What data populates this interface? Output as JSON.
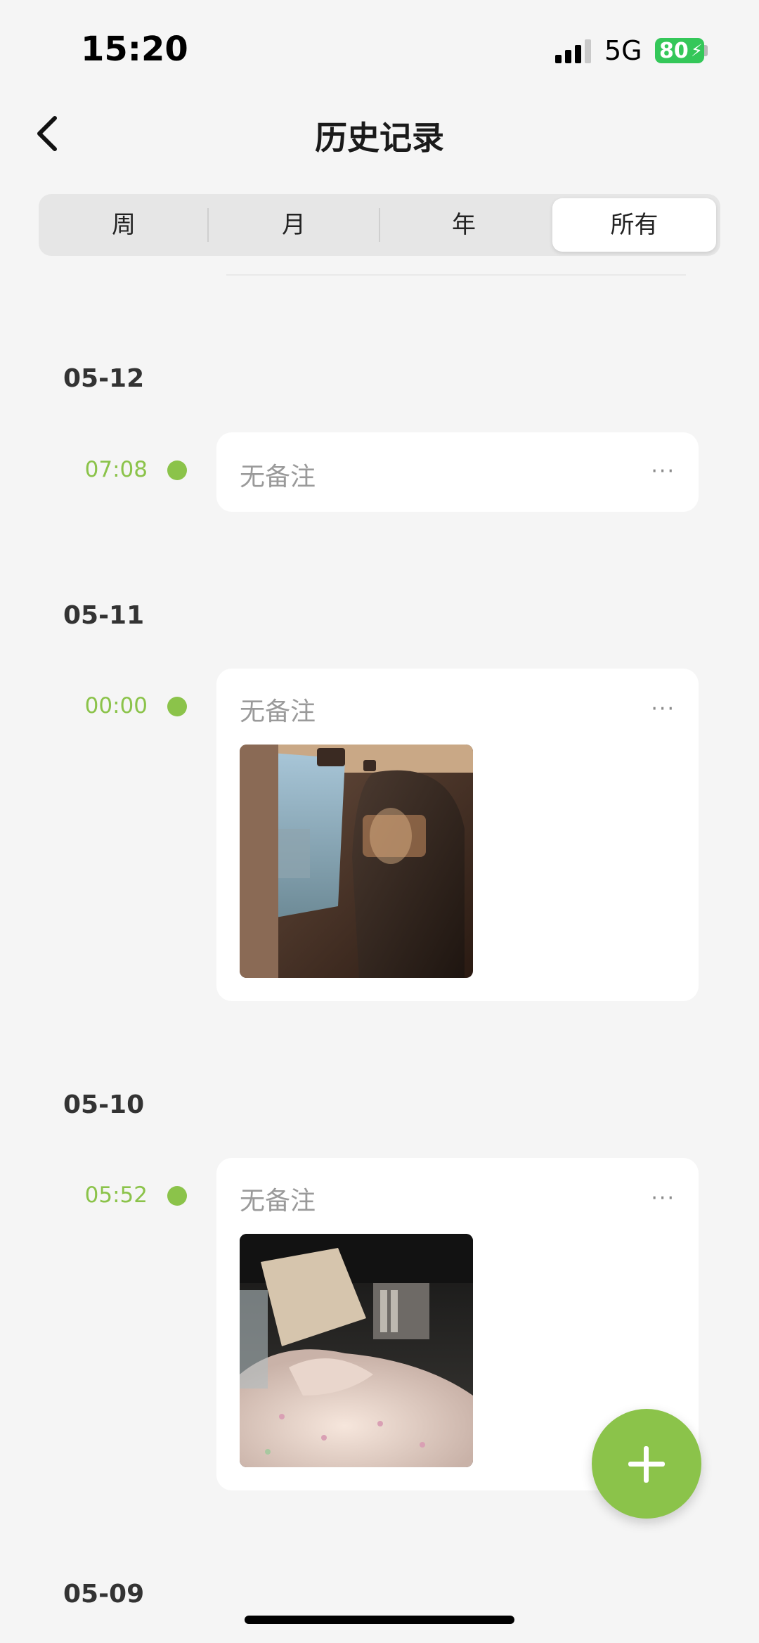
{
  "status_bar": {
    "time": "15:20",
    "network": "5G",
    "battery": "80"
  },
  "header": {
    "title": "历史记录"
  },
  "tabs": [
    {
      "label": "周",
      "active": false
    },
    {
      "label": "月",
      "active": false
    },
    {
      "label": "年",
      "active": false
    },
    {
      "label": "所有",
      "active": true
    }
  ],
  "entries": [
    {
      "date": "05-12",
      "time": "07:08",
      "note": "无备注",
      "more": "···",
      "photo": null
    },
    {
      "date": "05-11",
      "time": "00:00",
      "note": "无备注",
      "more": "···",
      "photo": "car interior from rear seat"
    },
    {
      "date": "05-10",
      "time": "05:52",
      "note": "无备注",
      "more": "···",
      "photo": "blanket on seat"
    },
    {
      "date": "05-09"
    }
  ],
  "colors": {
    "accent": "#8bc34a",
    "background": "#f5f5f5",
    "card": "#ffffff"
  },
  "fab_icon": "plus-icon"
}
